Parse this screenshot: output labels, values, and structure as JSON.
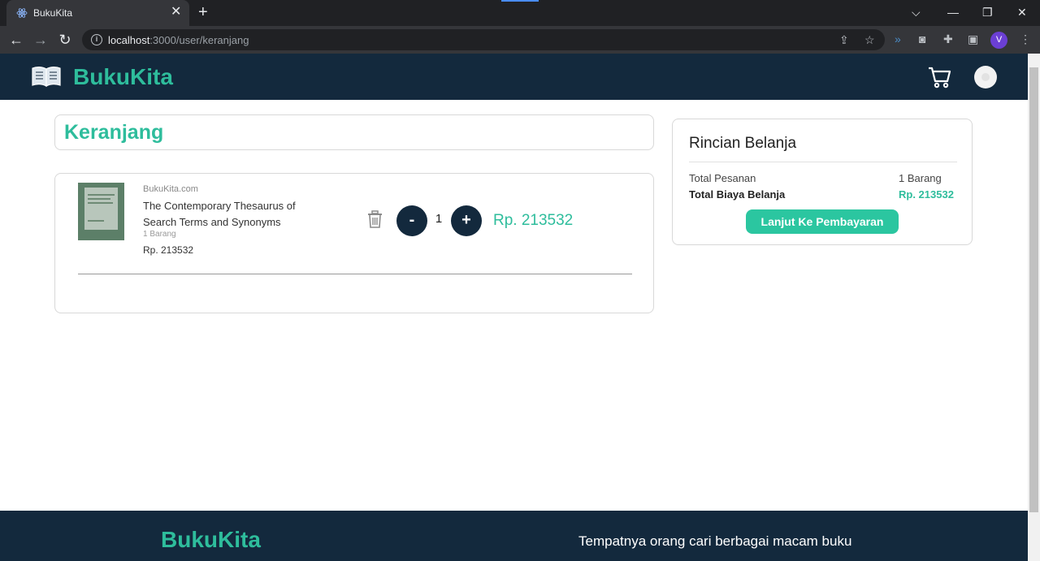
{
  "browser": {
    "tab_title": "BukuKita",
    "url_host": "localhost",
    "url_path": ":3000/user/keranjang",
    "profile_initial": "V"
  },
  "navbar": {
    "brand": "BukuKita",
    "icons": [
      "open-book-icon",
      "shopping-cart-icon",
      "avatar"
    ]
  },
  "page": {
    "title": "Keranjang"
  },
  "cart": {
    "items": [
      {
        "store": "BukuKita.com",
        "title": "The Contemporary Thesaurus of Search Terms and Synonyms",
        "quantity_label": "1 Barang",
        "price": "Rp. 213532",
        "quantity": "1",
        "line_total": "Rp. 213532",
        "decrement_label": "-",
        "increment_label": "+"
      }
    ]
  },
  "summary": {
    "title": "Rincian Belanja",
    "total_orders_label": "Total Pesanan",
    "total_orders_value": "1 Barang",
    "total_cost_label": "Total Biaya Belanja",
    "total_cost_value": "Rp. 213532",
    "checkout_label": "Lanjut Ke Pembayaran"
  },
  "footer": {
    "brand": "BukuKita",
    "tagline": "Tempatnya orang cari berbagai macam buku"
  },
  "colors": {
    "navy": "#13293d",
    "accent": "#2ebd9c"
  }
}
